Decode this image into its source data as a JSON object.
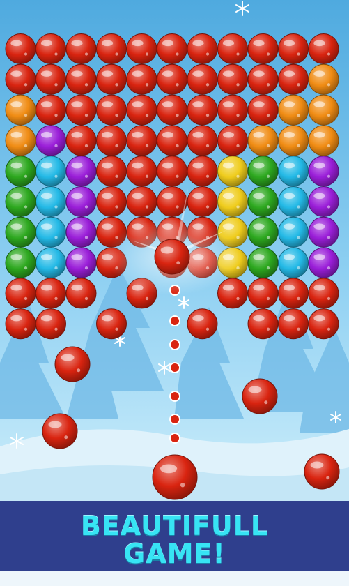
{
  "banner": {
    "title": "BEAUTIFULL\nGAME!"
  },
  "colors": {
    "red": "#d92410",
    "orange": "#f08c14",
    "purple": "#9a1ed8",
    "green": "#2da81f",
    "cyan": "#23b9e6",
    "yellow": "#efcc1c",
    "sky_top": "#5fb2e5",
    "sky_bottom": "#bde6f8",
    "banner_bg": "#2f3f8d",
    "banner_text": "#37e4f4"
  },
  "game": {
    "grid": [
      [
        "R",
        "R",
        "R",
        "R",
        "R",
        "R",
        "R",
        "R",
        "R",
        "R",
        "R"
      ],
      [
        "R",
        "R",
        "R",
        "R",
        "R",
        "R",
        "R",
        "R",
        "R",
        "R",
        "O"
      ],
      [
        "O",
        "R",
        "R",
        "R",
        "R",
        "R",
        "R",
        "R",
        "R",
        "O",
        "O"
      ],
      [
        "O",
        "P",
        "R",
        "R",
        "R",
        "R",
        "R",
        "R",
        "O",
        "O",
        "O"
      ],
      [
        "G",
        "C",
        "P",
        "R",
        "R",
        "R",
        "R",
        "Y",
        "G",
        "C",
        "P"
      ],
      [
        "G",
        "C",
        "P",
        "R",
        "R",
        "R",
        "R",
        "Y",
        "G",
        "C",
        "P"
      ],
      [
        "G",
        "C",
        "P",
        "R",
        "R",
        "R",
        "R",
        "Y",
        "G",
        "C",
        "P"
      ],
      [
        "G",
        "C",
        "P",
        "R",
        "",
        "R",
        "R",
        "Y",
        "G",
        "C",
        "P"
      ],
      [
        "R",
        "R",
        "R",
        "",
        "R",
        "",
        "",
        "R",
        "R",
        "R",
        "R"
      ],
      [
        "R",
        "R",
        "",
        "R",
        "",
        "",
        "R",
        "",
        "R",
        "R",
        "R"
      ]
    ],
    "shooter_bubble": "R",
    "flying_bubble": "R",
    "falling_bubbles": [
      "R",
      "R",
      "R",
      "R"
    ],
    "aim_dots": 7
  }
}
